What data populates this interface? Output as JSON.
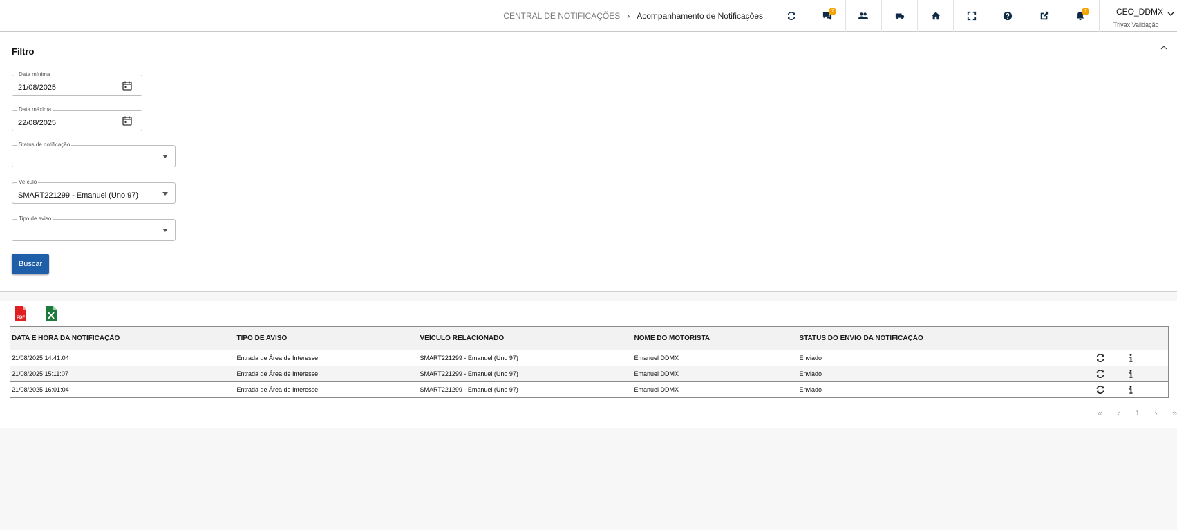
{
  "breadcrumb": {
    "root": "CENTRAL DE NOTIFICAÇÕES",
    "separator": "›",
    "current": "Acompanhamento de Notificações"
  },
  "toolbar": {
    "icons": [
      "refresh-icon",
      "chat-icon",
      "users-icon",
      "truck-icon",
      "home-icon",
      "fullscreen-icon",
      "help-icon",
      "external-link-icon",
      "bell-icon"
    ],
    "chat_badge": "7",
    "bell_badge": "1"
  },
  "user": {
    "name": "CEO_DDMX",
    "company": "Triyax Validação"
  },
  "filter": {
    "title": "Filtro",
    "date_min": {
      "label": "Data mínima",
      "value": "21/08/2025"
    },
    "date_max": {
      "label": "Data máxima",
      "value": "22/08/2025"
    },
    "status": {
      "label": "Status de notificação",
      "value": ""
    },
    "vehicle": {
      "label": "Veículo",
      "value": "SMART221299 - Emanuel (Uno 97)"
    },
    "notice_type": {
      "label": "Tipo de aviso",
      "value": ""
    },
    "search_label": "Buscar"
  },
  "table": {
    "headers": [
      "DATA E HORA DA NOTIFICAÇÃO",
      "TIPO DE AVISO",
      "VEÍCULO RELACIONADO",
      "NOME DO MOTORISTA",
      "STATUS DO ENVIO DA NOTIFICAÇÃO"
    ],
    "rows": [
      [
        "21/08/2025 14:41:04",
        "Entrada de Área de Interesse",
        "SMART221299 - Emanuel (Uno 97)",
        "Emanuel DDMX",
        "Enviado"
      ],
      [
        "21/08/2025 15:11:07",
        "Entrada de Área de Interesse",
        "SMART221299 - Emanuel (Uno 97)",
        "Emanuel DDMX",
        "Enviado"
      ],
      [
        "21/08/2025 16:01:04",
        "Entrada de Área de Interesse",
        "SMART221299 - Emanuel (Uno 97)",
        "Emanuel DDMX",
        "Enviado"
      ]
    ]
  },
  "pager": {
    "first": "«",
    "prev": "‹",
    "page": "1",
    "next": "›",
    "last": "»"
  },
  "colors": {
    "primary": "#1f5ea8",
    "badge": "#f5a300",
    "pdf": "#e02020",
    "excel": "#1d7a3a",
    "icon": "#0f2a47"
  }
}
